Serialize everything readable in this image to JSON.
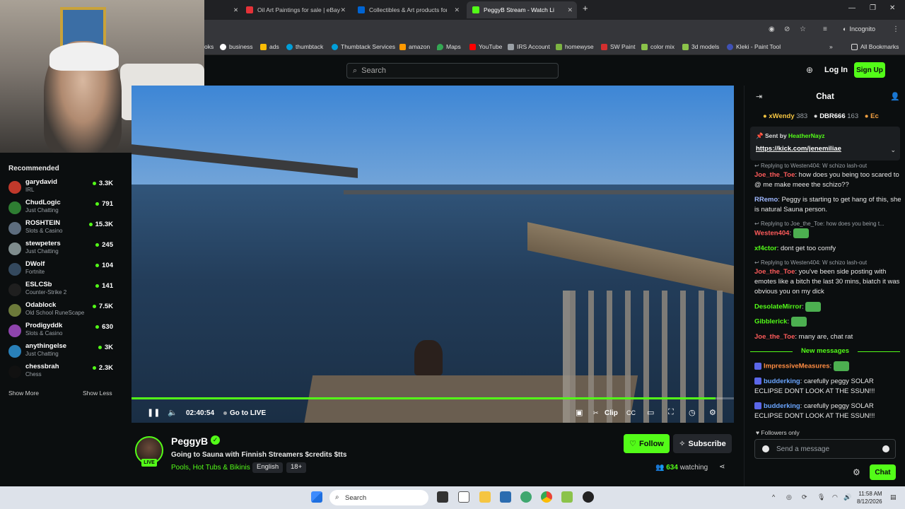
{
  "browser": {
    "tabs": [
      {
        "title": "Oil Art Paintings for sale | eBay",
        "favicon_color": "#e53238",
        "active": false
      },
      {
        "title": "Collectibles & Art products for sale | eBay",
        "favicon_color": "#0064d2",
        "active": false
      },
      {
        "title": "PeggyB Stream - Watch Live",
        "favicon_color": "#53fc18",
        "active": true
      }
    ],
    "new_tab_icon": "plus-icon",
    "incognito_label": "Incognito",
    "bookmarks": [
      "oks",
      "business",
      "ads",
      "thumbtack",
      "Thumbtack Services",
      "amazon",
      "Maps",
      "YouTube",
      "IRS Account",
      "homewyse",
      "SW Paint",
      "color mix",
      "3d models",
      "Kleki - Paint Tool"
    ],
    "all_bookmarks": "All Bookmarks"
  },
  "header": {
    "search_placeholder": "Search",
    "login": "Log In",
    "signup": "Sign Up"
  },
  "sidebar": {
    "title": "Recommended",
    "channels": [
      {
        "name": "garydavid",
        "category": "IRL",
        "viewers": "3.3K",
        "color": "#c0392b"
      },
      {
        "name": "ChudLogic",
        "category": "Just Chatting",
        "viewers": "791",
        "color": "#2e7d32"
      },
      {
        "name": "ROSHTEIN",
        "category": "Slots & Casino",
        "viewers": "15.3K",
        "color": "#5d6d7e"
      },
      {
        "name": "stewpeters",
        "category": "Just Chatting",
        "viewers": "245",
        "color": "#7f8c8d"
      },
      {
        "name": "DWolf",
        "category": "Fortnite",
        "viewers": "104",
        "color": "#34495e"
      },
      {
        "name": "ESLCSb",
        "category": "Counter-Strike 2",
        "viewers": "141",
        "color": "#1f1f1f"
      },
      {
        "name": "Odablock",
        "category": "Old School RuneScape",
        "viewers": "7.5K",
        "color": "#6c7a3a"
      },
      {
        "name": "Prodigyddk",
        "category": "Slots & Casino",
        "viewers": "630",
        "color": "#8e44ad"
      },
      {
        "name": "anythingelse",
        "category": "Just Chatting",
        "viewers": "3K",
        "color": "#2980b9"
      },
      {
        "name": "chessbrah",
        "category": "Chess",
        "viewers": "2.3K",
        "color": "#111111"
      }
    ],
    "show_more": "Show More",
    "show_less": "Show Less"
  },
  "player": {
    "time": "02:40:54",
    "go_live": "Go to LIVE",
    "clip": "Clip",
    "progress_fraction": 0.97
  },
  "stream": {
    "name": "PeggyB",
    "live": "LIVE",
    "title": "Going to Sauna with Finnish Streamers $credits $tts",
    "category": "Pools, Hot Tubs & Bikinis",
    "tags": [
      "English",
      "18+"
    ],
    "follow": "Follow",
    "subscribe": "Subscribe",
    "viewers": "634",
    "watching_label": "watching"
  },
  "chat": {
    "title": "Chat",
    "gifters": [
      {
        "name": "xWendy",
        "count": "383",
        "color": "#f5c542"
      },
      {
        "name": "DBR666",
        "count": "163",
        "color": "#ffffff"
      },
      {
        "name": "Ec",
        "count": "",
        "color": "#f5a142"
      }
    ],
    "pinned": {
      "sent_by": "Sent by",
      "user": "HeatherNayz",
      "link": "https://kick.com/jenemiliae"
    },
    "messages": [
      {
        "reply": "Replying to Westen404: W schizo lash-out",
        "user": "Joe_the_Toe",
        "color": "#ff5b5b",
        "text": "how does you being too scared to @ me make meee the schizo??"
      },
      {
        "reply": "",
        "user": "RRemo",
        "color": "#9fb8ff",
        "text": "Peggy is starting to get hang of this, she is natural Sauna person."
      },
      {
        "reply": "Replying to Joe_the_Toe: how does you being t...",
        "user": "Westen404",
        "color": "#ff5b5b",
        "text": ""
      },
      {
        "reply": "",
        "user": "xf4ctor",
        "color": "#53fc18",
        "text": "dont get too comfy"
      },
      {
        "reply": "Replying to Westen404: W schizo lash-out",
        "user": "Joe_the_Toe",
        "color": "#ff5b5b",
        "text": "you've been side posting with emotes like a bitch the last 30 mins, biatch it was obvious you on my dick"
      },
      {
        "reply": "",
        "user": "DesolateMirror",
        "color": "#53fc18",
        "text": ""
      },
      {
        "reply": "",
        "user": "Gibblerick",
        "color": "#53fc18",
        "text": ""
      },
      {
        "reply": "",
        "user": "Joe_the_Toe",
        "color": "#ff5b5b",
        "text": "many are, chat rat"
      }
    ],
    "new_messages": "New messages",
    "new": [
      {
        "user": "ImpressiveMeasures",
        "color": "#ff8c42",
        "text": ""
      },
      {
        "user": "budderking",
        "color": "#6aa5ff",
        "text": "carefully peggy SOLAR ECLIPSE DONT LOOK AT THE SSUN!!!"
      },
      {
        "user": "budderking",
        "color": "#6aa5ff",
        "text": "carefully peggy SOLAR ECLIPSE DONT LOOK AT THE SSUN!!!"
      }
    ],
    "followers_only": "Followers only",
    "input_placeholder": "Send a message",
    "send": "Chat"
  },
  "taskbar": {
    "search": "Search",
    "time": "11:58 AM",
    "date": "8/12/2026"
  }
}
